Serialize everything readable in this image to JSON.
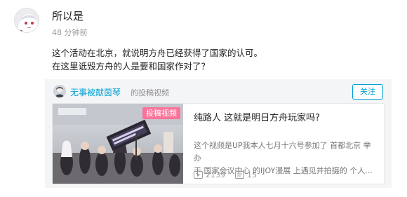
{
  "comment": {
    "username": "所以是",
    "timestamp": "48 分钟前",
    "lines": [
      "这个活动在北京，就说明方舟已经获得了国家的认可。",
      "在这里诋毁方舟的人是要和国家作对了？"
    ]
  },
  "card": {
    "uploader_name": "无事被献茵琴",
    "action_text": "的投稿视频",
    "follow_label": "关注",
    "video": {
      "badge": "投稿视频",
      "title": "纯路人 这就是明日方舟玩家吗?",
      "description_lines": [
        "这个视频是UP我本人七月十六号参加了 首都北京 举办",
        "于 国家会议中心 的IJOY漫展 上遇见并拍摄的 个人..."
      ],
      "play_count": "2139",
      "danmaku_count": "15"
    }
  },
  "icons": {
    "play_count": "play-count-icon",
    "danmaku": "danmaku-icon"
  },
  "colors": {
    "accent_blue": "#00a1d6",
    "badge_pink": "#fb7299"
  }
}
